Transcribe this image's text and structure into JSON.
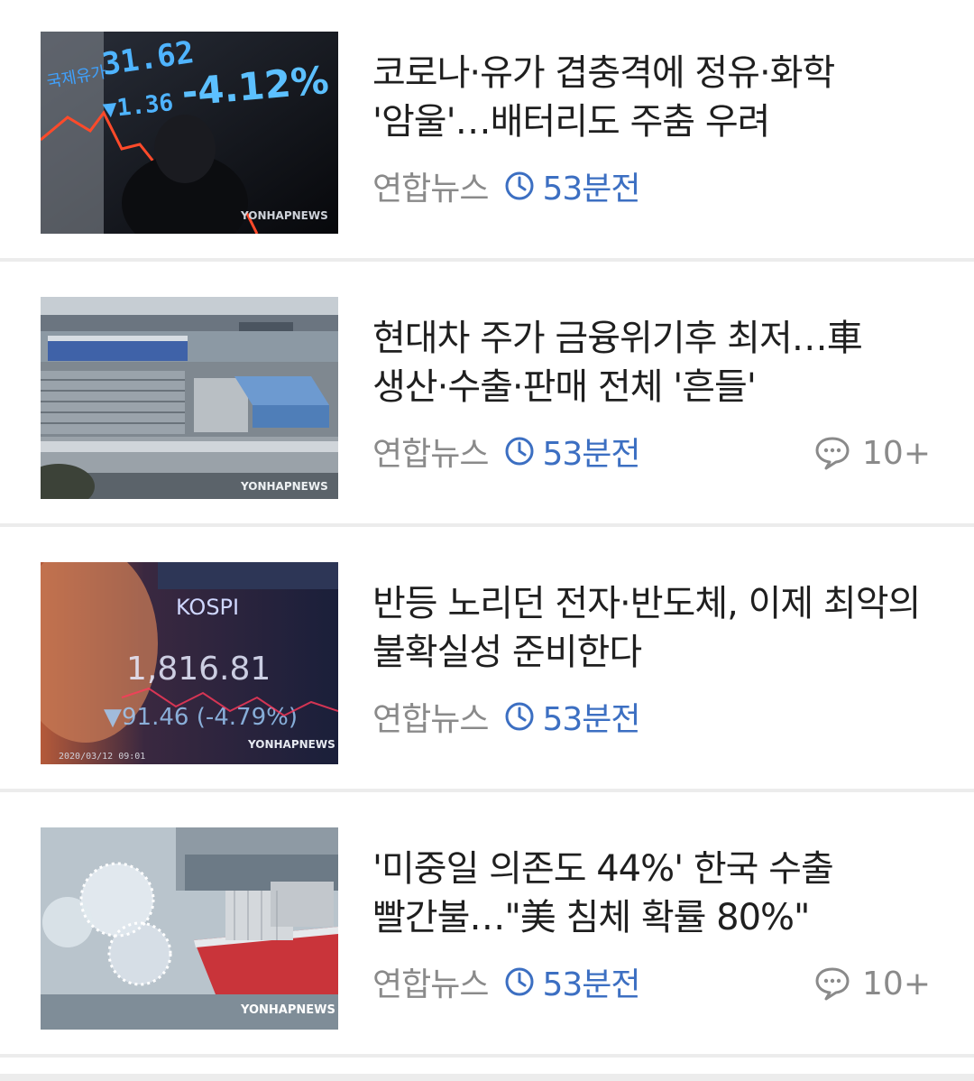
{
  "feed": {
    "items": [
      {
        "headline": "코로나·유가 겹충격에 정유·화학 '암울'…배터리도 주춤 우려",
        "source": "연합뉴스",
        "time": "53분전",
        "comments": "",
        "thumbnail_icon": "oil-price-board-image",
        "thumb_text": {
          "top": "31.62",
          "mid": "▼1.36",
          "pct": "-4.12%",
          "label": "국제유가",
          "watermark": "YONHAPNEWS"
        }
      },
      {
        "headline": "현대차 주가 금융위기후 최저…車 생산·수출·판매 전체 '흔들'",
        "source": "연합뉴스",
        "time": "53분전",
        "comments": "10+",
        "thumbnail_icon": "car-port-image",
        "thumb_text": {
          "watermark": "YONHAPNEWS"
        }
      },
      {
        "headline": "반등 노리던 전자·반도체, 이제 최악의 불확실성 준비한다",
        "source": "연합뉴스",
        "time": "53분전",
        "comments": "",
        "thumbnail_icon": "kospi-board-image",
        "thumb_text": {
          "top": "KOSPI",
          "mid": "1,816.81",
          "low": "▼91.46 (-4.79%)",
          "date": "2020/03/12 09:01",
          "watermark": "YONHAPNEWS"
        }
      },
      {
        "headline": "'미중일 의존도 44%' 한국 수출 빨간불…\"美 침체 확률 80%\"",
        "source": "연합뉴스",
        "time": "53분전",
        "comments": "10+",
        "thumbnail_icon": "virus-cargo-ship-image",
        "thumb_text": {
          "watermark": "YONHAPNEWS"
        }
      }
    ]
  },
  "colors": {
    "time_accent": "#3c6fc2",
    "meta_gray": "#8a8a8a",
    "headline": "#1f1f1f",
    "divider": "#ececec"
  },
  "icons": {
    "clock": "clock-icon",
    "comment": "comment-bubble-icon"
  }
}
